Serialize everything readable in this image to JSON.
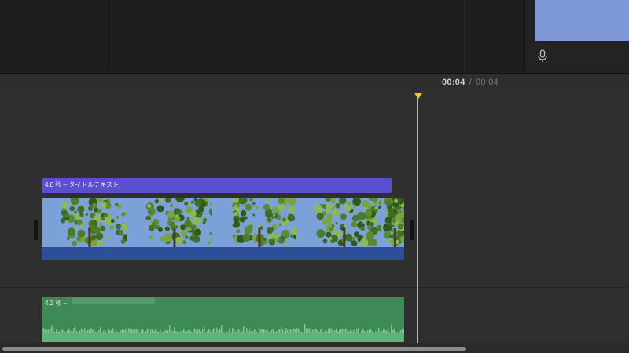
{
  "playhead": {
    "current": "00:04",
    "separator": "/",
    "total": "00:04"
  },
  "clips": {
    "title": {
      "label": "4.0 秒 – タイトルテキスト"
    },
    "video": {
      "thumbnail_count": 5
    },
    "audio": {
      "label": "4.2 秒 –"
    }
  },
  "icons": {
    "microphone": "microphone-icon"
  },
  "colors": {
    "title_clip": "#5a4fcf",
    "video_clip": "#2d4f9a",
    "audio_clip": "#3e8a57",
    "playhead": "#e4c21c"
  }
}
